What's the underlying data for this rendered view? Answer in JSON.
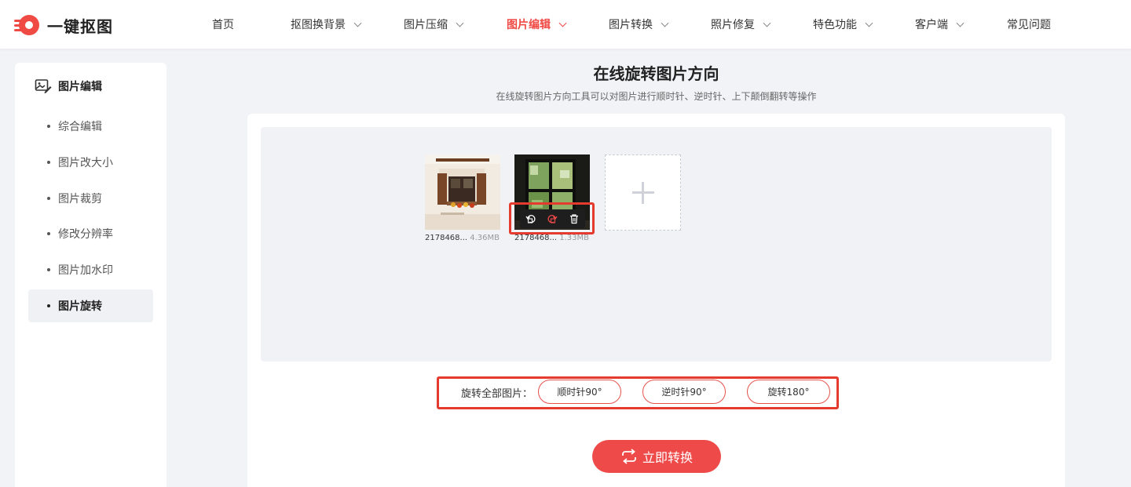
{
  "brand": {
    "name": "一键抠图",
    "accent": "#f04a45"
  },
  "nav": [
    {
      "label": "首页",
      "dropdown": false,
      "active": false
    },
    {
      "label": "抠图换背景",
      "dropdown": true,
      "active": false
    },
    {
      "label": "图片压缩",
      "dropdown": true,
      "active": false
    },
    {
      "label": "图片编辑",
      "dropdown": true,
      "active": true
    },
    {
      "label": "图片转换",
      "dropdown": true,
      "active": false
    },
    {
      "label": "照片修复",
      "dropdown": true,
      "active": false
    },
    {
      "label": "特色功能",
      "dropdown": true,
      "active": false
    },
    {
      "label": "客户端",
      "dropdown": true,
      "active": false
    },
    {
      "label": "常见问题",
      "dropdown": false,
      "active": false
    }
  ],
  "sidebar": {
    "title": "图片编辑",
    "icon": "image-edit-icon",
    "items": [
      {
        "label": "综合编辑",
        "active": false
      },
      {
        "label": "图片改大小",
        "active": false
      },
      {
        "label": "图片裁剪",
        "active": false
      },
      {
        "label": "修改分辨率",
        "active": false
      },
      {
        "label": "图片加水印",
        "active": false
      },
      {
        "label": "图片旋转",
        "active": true
      }
    ]
  },
  "page": {
    "title": "在线旋转图片方向",
    "subtitle": "在线旋转图片方向工具可以对图片进行顺时针、逆时针、上下颠倒翻转等操作"
  },
  "files": [
    {
      "name": "2178468...",
      "size": "4.36MB"
    },
    {
      "name": "2178468...",
      "size": "1.33MB"
    }
  ],
  "thumb_tools": [
    "rotate-left-icon",
    "rotate-right-icon",
    "trash-icon"
  ],
  "rotate_all": {
    "label": "旋转全部图片：",
    "buttons": [
      "顺时针90°",
      "逆时针90°",
      "旋转180°"
    ]
  },
  "convert_button": "立即转换"
}
